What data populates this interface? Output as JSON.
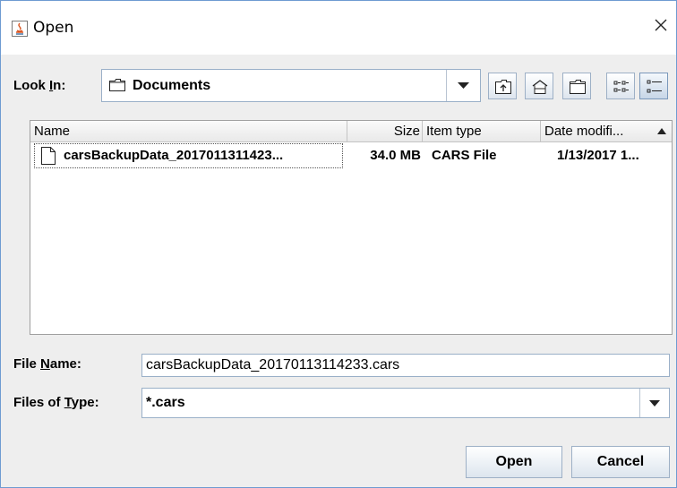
{
  "window": {
    "title": "Open",
    "app_icon": "java-icon",
    "close_icon": "close-icon"
  },
  "look_in": {
    "label_pre": "Look ",
    "label_mn": "I",
    "label_post": "n:",
    "value": "Documents"
  },
  "toolbar": {
    "buttons": [
      "up-one-level-icon",
      "home-icon",
      "new-folder-icon",
      "list-view-icon",
      "details-view-icon"
    ],
    "selected": "details-view-icon"
  },
  "file_list": {
    "headers": {
      "name": "Name",
      "size": "Size",
      "type": "Item type",
      "date": "Date modifi..."
    },
    "sort_indicator": "sort-ascending-icon",
    "rows": [
      {
        "name": "carsBackupData_2017011311423...",
        "size": "34.0 MB",
        "type": "CARS File",
        "date": "1/13/2017 1..."
      }
    ]
  },
  "file_name": {
    "label_pre": "File ",
    "label_mn": "N",
    "label_post": "ame:",
    "value": "carsBackupData_20170113114233.cars"
  },
  "files_of_type": {
    "label_pre": "Files of ",
    "label_mn": "T",
    "label_post": "ype:",
    "value": "*.cars"
  },
  "buttons": {
    "open": "Open",
    "cancel": "Cancel"
  },
  "colors": {
    "border_accent": "#6e9bd1",
    "panel_bg": "#eeeeee"
  }
}
